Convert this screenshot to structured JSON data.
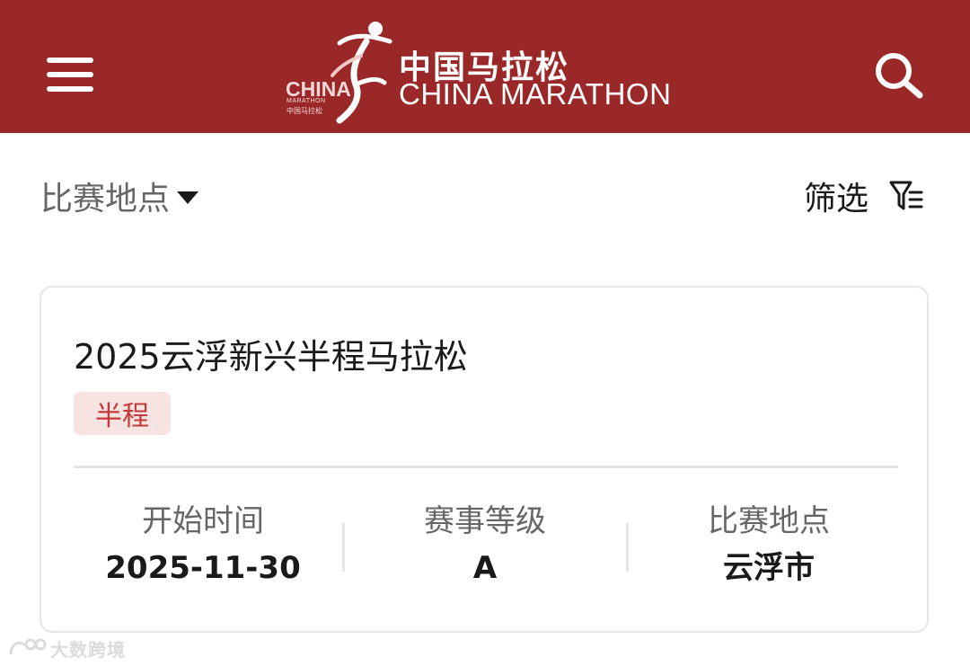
{
  "header": {
    "logo_mark": {
      "china": "CHINA",
      "marathon": "MARATHON",
      "cn_small": "中国马拉松"
    },
    "title_cn": "中国马拉松",
    "title_en": "CHINA MARATHON",
    "bg_color": "#9b2828"
  },
  "filters": {
    "location_label": "比赛地点",
    "filter_label": "筛选"
  },
  "events": [
    {
      "title": "2025云浮新兴半程马拉松",
      "tag": "半程",
      "start_time_label": "开始时间",
      "start_time": "2025-11-30",
      "level_label": "赛事等级",
      "level": "A",
      "location_label": "比赛地点",
      "location": "云浮市"
    }
  ],
  "watermark": "大数跨境",
  "icons": {
    "menu": "hamburger-menu-icon",
    "search": "search-icon",
    "caret": "caret-down-icon",
    "filter": "funnel-filter-icon"
  }
}
